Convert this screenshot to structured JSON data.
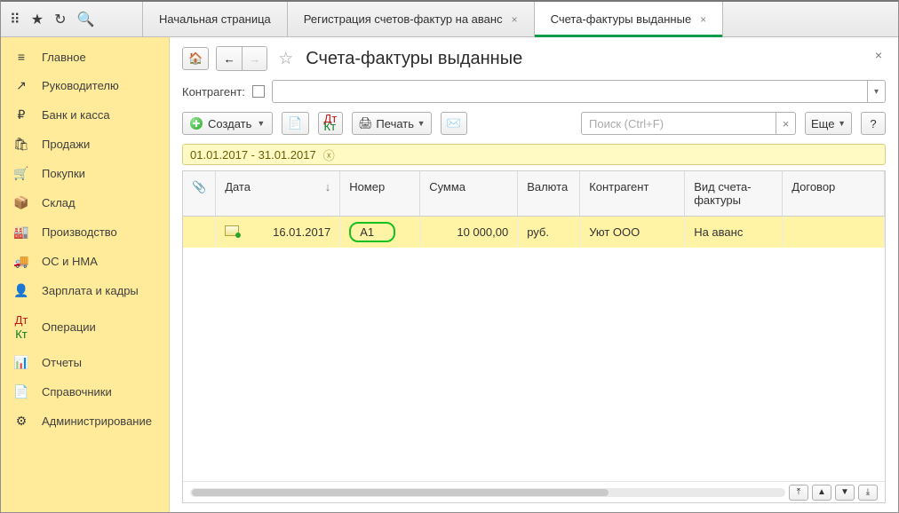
{
  "tabs": {
    "home": "Начальная страница",
    "adv": "Регистрация счетов-фактур на аванс",
    "active": "Счета-фактуры выданные"
  },
  "nav": {
    "items": [
      {
        "icon": "≡",
        "label": "Главное"
      },
      {
        "icon": "↗",
        "label": "Руководителю"
      },
      {
        "icon": "₽",
        "label": "Банк и касса"
      },
      {
        "icon": "🛍",
        "label": "Продажи"
      },
      {
        "icon": "🛒",
        "label": "Покупки"
      },
      {
        "icon": "📦",
        "label": "Склад"
      },
      {
        "icon": "🏭",
        "label": "Производство"
      },
      {
        "icon": "🚚",
        "label": "ОС и НМА"
      },
      {
        "icon": "👤",
        "label": "Зарплата и кадры"
      },
      {
        "icon": "ДК",
        "label": "Операции"
      },
      {
        "icon": "📊",
        "label": "Отчеты"
      },
      {
        "icon": "📄",
        "label": "Справочники"
      },
      {
        "icon": "⚙",
        "label": "Администрирование"
      }
    ]
  },
  "page": {
    "title": "Счета-фактуры выданные",
    "filter_label": "Контрагент:",
    "create_label": "Создать",
    "print_label": "Печать",
    "search_placeholder": "Поиск (Ctrl+F)",
    "more_label": "Еще",
    "date_chip": "01.01.2017 - 31.01.2017"
  },
  "table": {
    "headers": {
      "attach": "📎",
      "date": "Дата",
      "num": "Номер",
      "sum": "Сумма",
      "cur": "Валюта",
      "ctr": "Контрагент",
      "type": "Вид счета-фактуры",
      "contract": "Договор"
    },
    "rows": [
      {
        "date": "16.01.2017",
        "num": "А1",
        "sum": "10 000,00",
        "cur": "руб.",
        "ctr": "Уют ООО",
        "type": "На аванс",
        "contract": ""
      }
    ]
  }
}
